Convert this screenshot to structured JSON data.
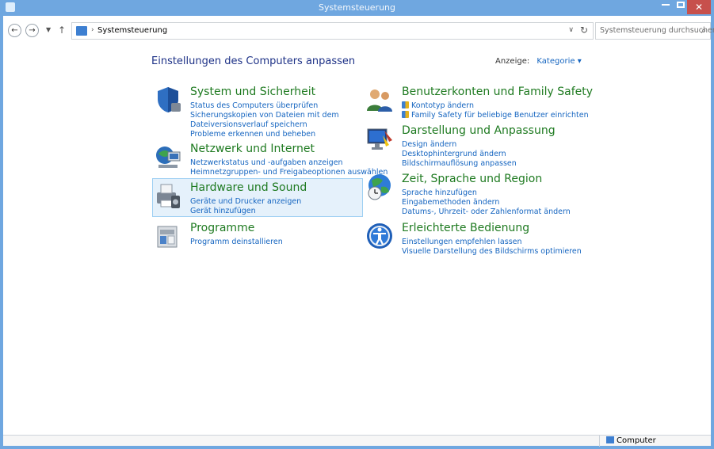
{
  "window": {
    "title": "Systemsteuerung",
    "close_label": "✕"
  },
  "addressbar": {
    "back_icon": "back-arrow-icon",
    "forward_icon": "forward-arrow-icon",
    "path": "Systemsteuerung",
    "search_placeholder": "Systemsteuerung durchsuchen"
  },
  "main": {
    "title": "Einstellungen des Computers anpassen",
    "view_label": "Anzeige:",
    "view_value": "Kategorie ▾",
    "categories": [
      {
        "heading": "System und Sicherheit",
        "icon": "shield-icon",
        "links": [
          "Status des Computers überprüfen",
          "Sicherungskopien von Dateien mit dem",
          "Dateiversionsverlauf speichern",
          "Probleme erkennen und beheben"
        ]
      },
      {
        "heading": "Netzwerk und Internet",
        "icon": "network-icon",
        "links": [
          "Netzwerkstatus und -aufgaben anzeigen",
          "Heimnetzgruppen- und Freigabeoptionen auswählen"
        ]
      },
      {
        "heading": "Hardware und Sound",
        "icon": "printer-icon",
        "links": [
          "Geräte und Drucker anzeigen",
          "Gerät hinzufügen"
        ]
      },
      {
        "heading": "Programme",
        "icon": "programs-icon",
        "links": [
          "Programm deinstallieren"
        ]
      },
      {
        "heading": "Benutzerkonten und Family Safety",
        "icon": "users-icon",
        "links": [
          "Kontotyp ändern",
          "Family Safety für beliebige Benutzer einrichten"
        ]
      },
      {
        "heading": "Darstellung und Anpassung",
        "icon": "display-icon",
        "links": [
          "Design ändern",
          "Desktophintergrund ändern",
          "Bildschirmauflösung anpassen"
        ]
      },
      {
        "heading": "Zeit, Sprache und Region",
        "icon": "clock-globe-icon",
        "links": [
          "Sprache hinzufügen",
          "Eingabemethoden ändern",
          "Datums-, Uhrzeit- oder Zahlenformat ändern"
        ]
      },
      {
        "heading": "Erleichterte Bedienung",
        "icon": "accessibility-icon",
        "links": [
          "Einstellungen empfehlen lassen",
          "Visuelle Darstellung des Bildschirms optimieren"
        ]
      }
    ]
  },
  "statusbar": {
    "location": "Computer"
  },
  "colors": {
    "accent": "#6fa7e0",
    "heading_green": "#1e7a20",
    "link_blue": "#1565c0",
    "title_blue": "#1e3287",
    "highlight": "#e5f1fb"
  }
}
